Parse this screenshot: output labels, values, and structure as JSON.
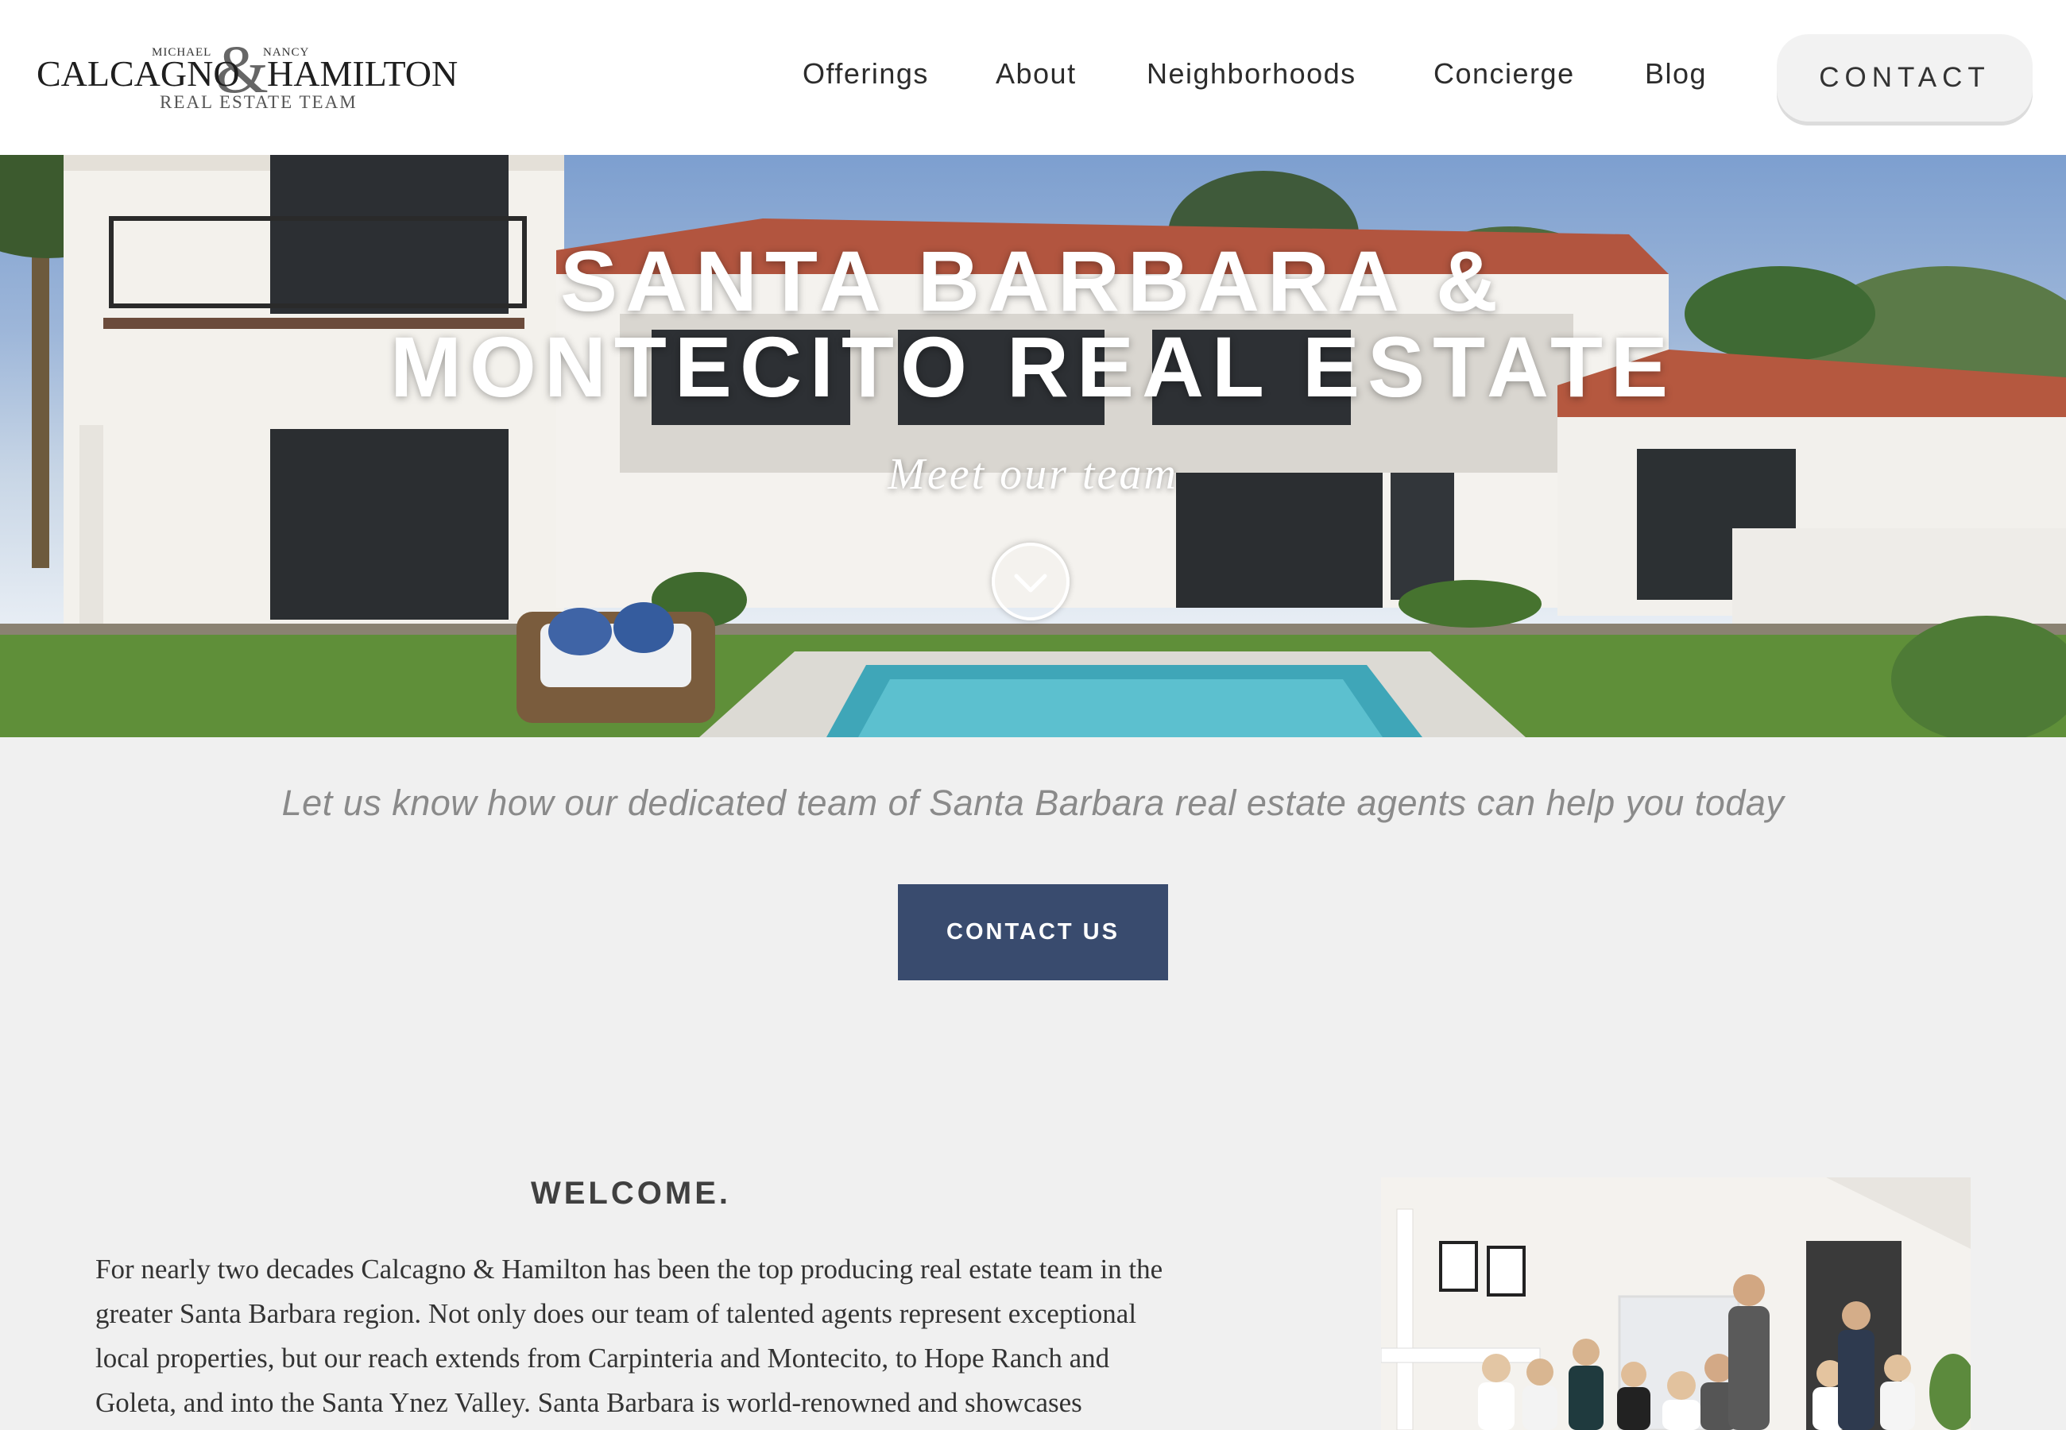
{
  "logo": {
    "first_name_small": "MICHAEL",
    "second_name_small": "NANCY",
    "surname_1": "CALCAGNO",
    "ampersand": "&",
    "surname_2": "HAMILTON",
    "team_line": "REAL ESTATE TEAM"
  },
  "nav": {
    "items": [
      {
        "label": "Offerings"
      },
      {
        "label": "About"
      },
      {
        "label": "Neighborhoods"
      },
      {
        "label": "Concierge"
      },
      {
        "label": "Blog"
      }
    ],
    "contact_label": "CONTACT"
  },
  "hero": {
    "title_line1": "SANTA BARBARA &",
    "title_line2": "MONTECITO REAL ESTATE",
    "subtitle": "Meet our team"
  },
  "cta": {
    "tagline": "Let us know how our dedicated team of Santa Barbara real estate agents can help you today",
    "button_label": "CONTACT US"
  },
  "welcome": {
    "heading": "WELCOME.",
    "body": "For nearly two decades Calcagno & Hamilton has been the top producing real estate team in the greater Santa Barbara region. Not only does our team of talented agents represent exceptional local properties, but our reach extends from Carpinteria and Montecito, to Hope Ranch and Goleta, and into the Santa Ynez Valley. Santa Barbara is world-renowned and showcases"
  },
  "colors": {
    "accent_button": "#394b6e",
    "page_background": "#f0f0f0",
    "header_background": "#ffffff"
  }
}
